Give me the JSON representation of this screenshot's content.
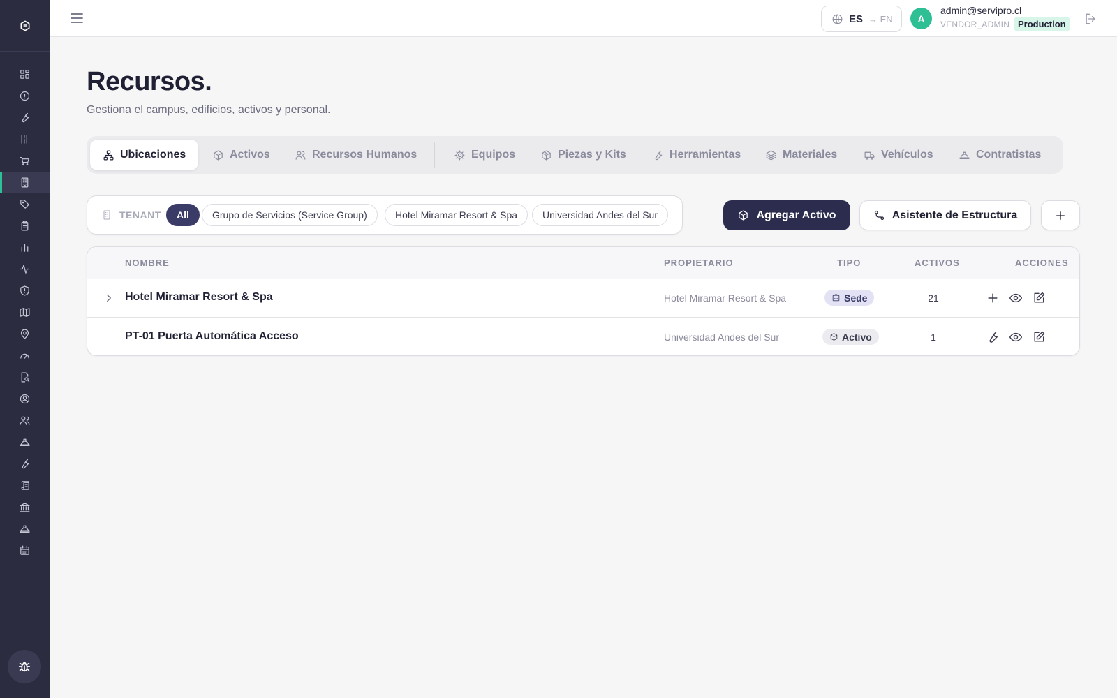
{
  "topbar": {
    "lang_current": "ES",
    "lang_alt": "→ EN",
    "avatar_initial": "A",
    "user_email": "admin@servipro.cl",
    "user_role": "VENDOR_ADMIN",
    "env_badge": "Production"
  },
  "page": {
    "title": "Recursos.",
    "subtitle": "Gestiona el campus, edificios, activos y personal."
  },
  "tabs": [
    {
      "label": "Ubicaciones",
      "icon": "sitemap-icon",
      "active": true
    },
    {
      "label": "Activos",
      "icon": "cube-icon"
    },
    {
      "label": "Recursos Humanos",
      "icon": "users-icon"
    },
    {
      "label": "Equipos",
      "icon": "cog-icon"
    },
    {
      "label": "Piezas y Kits",
      "icon": "package-icon"
    },
    {
      "label": "Herramientas",
      "icon": "wrench-icon"
    },
    {
      "label": "Materiales",
      "icon": "layers-icon"
    },
    {
      "label": "Vehículos",
      "icon": "truck-icon"
    },
    {
      "label": "Contratistas",
      "icon": "hardhat-icon"
    }
  ],
  "filter": {
    "label": "TENANT",
    "chips": [
      "All",
      "Grupo de Servicios (Service Group)",
      "Hotel Miramar Resort & Spa",
      "Universidad Andes del Sur"
    ],
    "active_chip": "All"
  },
  "actions": {
    "add_asset": "Agregar Activo",
    "structure_wizard": "Asistente de Estructura"
  },
  "table": {
    "headers": {
      "name": "NOMBRE",
      "owner": "PROPIETARIO",
      "type": "TIPO",
      "assets": "ACTIVOS",
      "actions": "ACCIONES"
    },
    "rows": [
      {
        "name": "Hotel Miramar Resort & Spa",
        "owner": "Hotel Miramar Resort & Spa",
        "type": "Sede",
        "assets": "21",
        "expandable": true
      },
      {
        "name": "PT-01 Puerta Automática Acceso",
        "owner": "Universidad Andes del Sur",
        "type": "Activo",
        "assets": "1",
        "expandable": false
      }
    ]
  },
  "sidebar": {
    "items": [
      "dashboard-icon",
      "alert-icon",
      "wrench-icon",
      "work-orders-icon",
      "cart-icon",
      "building-icon",
      "tag-icon",
      "clipboard-icon",
      "bar-chart-icon",
      "activity-icon",
      "shield-icon",
      "map-icon",
      "map-pin-icon",
      "gauge-icon",
      "file-search-icon",
      "user-circle-icon",
      "users-icon",
      "hardhat-icon",
      "wrench-icon",
      "scroll-icon",
      "bank-icon",
      "hardhat-icon",
      "calendar-icon"
    ],
    "active_index": 5
  },
  "colors": {
    "sidebar": "#2b2c40",
    "accent": "#2fbf94",
    "primary_button": "#2b2c4e",
    "chip_active": "#3a3b66"
  }
}
